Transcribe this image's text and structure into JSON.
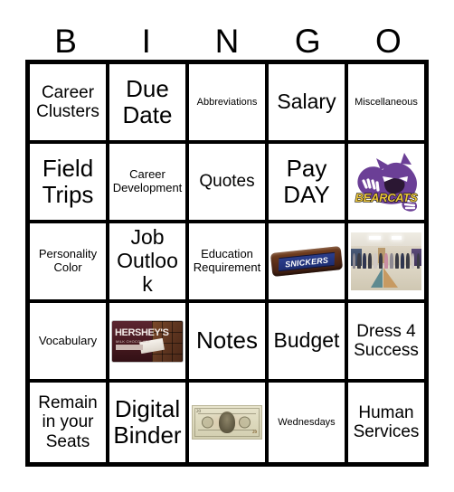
{
  "card": {
    "title": "BINGO Card",
    "header_letters": [
      "B",
      "I",
      "N",
      "G",
      "O"
    ],
    "rows": [
      [
        {
          "label": "Career Clusters",
          "type": "text",
          "size": "md"
        },
        {
          "label": "Due Date",
          "type": "text",
          "size": "xl"
        },
        {
          "label": "Abbreviations",
          "type": "text",
          "size": "xs"
        },
        {
          "label": "Salary",
          "type": "text",
          "size": "lg"
        },
        {
          "label": "Miscellaneous",
          "type": "text",
          "size": "xs"
        }
      ],
      [
        {
          "label": "Field Trips",
          "type": "text",
          "size": "xl"
        },
        {
          "label": "Career Development",
          "type": "text",
          "size": "sm"
        },
        {
          "label": "Quotes",
          "type": "text",
          "size": "md"
        },
        {
          "label": "Pay DAY",
          "type": "text",
          "size": "xl"
        },
        {
          "label": "Bearcats mascot logo",
          "type": "image",
          "image": "bearcats-logo",
          "image_text": "BEARCATS"
        }
      ],
      [
        {
          "label": "Personality Color",
          "type": "text",
          "size": "sm"
        },
        {
          "label": "Job Outlook",
          "type": "text",
          "size": "lg"
        },
        {
          "label": "Education Requirement",
          "type": "text",
          "size": "sm"
        },
        {
          "label": "Snickers candy bar",
          "type": "image",
          "image": "snickers-bar",
          "image_text": "SNICKERS"
        },
        {
          "label": "Group photo of students in hallway",
          "type": "image",
          "image": "group-photo"
        }
      ],
      [
        {
          "label": "Vocabulary",
          "type": "text",
          "size": "sm"
        },
        {
          "label": "Hershey's milk chocolate bar",
          "type": "image",
          "image": "hersheys-bar",
          "image_text": "HERSHEY'S",
          "image_subtext": "MILK CHOCOLATE"
        },
        {
          "label": "Notes",
          "type": "text",
          "size": "xl"
        },
        {
          "label": "Budget",
          "type": "text",
          "size": "lg"
        },
        {
          "label": "Dress 4 Success",
          "type": "text",
          "size": "md"
        }
      ],
      [
        {
          "label": "Remain in your Seats",
          "type": "text",
          "size": "md"
        },
        {
          "label": "Digital Binder",
          "type": "text",
          "size": "xl"
        },
        {
          "label": "Twenty dollar bill",
          "type": "image",
          "image": "twenty-dollar-bill",
          "image_text": "20"
        },
        {
          "label": "Wednesdays",
          "type": "text",
          "size": "xs"
        },
        {
          "label": "Human Services",
          "type": "text",
          "size": "md"
        }
      ]
    ]
  },
  "colors": {
    "background": "#ffffff",
    "grid_line": "#000000",
    "text": "#000000",
    "bearcats_purple": "#6b3f96",
    "bearcats_gold": "#e8c33a",
    "snickers_brown": "#5a2d18",
    "snickers_blue": "#23357f",
    "hersheys_maroon": "#4a1f26",
    "bill_green": "#ddd9bd"
  }
}
